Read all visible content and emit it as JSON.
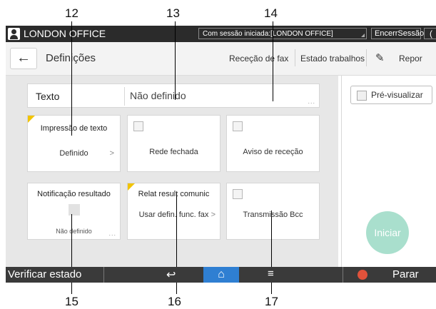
{
  "callouts": [
    "12",
    "13",
    "14",
    "15",
    "16",
    "17"
  ],
  "topbar": {
    "user_label": "LONDON OFFICE",
    "session_text": "Com sessão iniciada:[LONDON OFFICE]",
    "logout_label": "EncerrSessão",
    "moon_icon": "("
  },
  "header": {
    "back_icon": "←",
    "title": "Definições",
    "links": [
      "Receção de fax",
      "Estado trabalhos"
    ],
    "edit_icon": "✎",
    "reset_label": "Repor"
  },
  "texto_row": {
    "label": "Texto",
    "value": "Não definido",
    "dots": "..."
  },
  "tiles": [
    {
      "line1": "Impressão de texto",
      "line2": "Definido",
      "chevron": ">"
    },
    {
      "line2": "Rede fechada"
    },
    {
      "line2": "Aviso de receção"
    },
    {
      "line1": "Notificação resultado",
      "small": "Não definido",
      "dots": "..."
    },
    {
      "line1": "Relat result comunic",
      "line2": "Usar defin. func. fax",
      "chevron": ">"
    },
    {
      "line2": "Transmissão Bcc"
    }
  ],
  "preview": {
    "label": "Pré-visualizar"
  },
  "start_label": "Iniciar",
  "bottombar": {
    "verify_label": "Verificar estado",
    "back_icon": "↩",
    "home_icon": "⌂",
    "menu_icon": "≡",
    "stop_label": "Parar"
  },
  "colors": {
    "accent_yellow": "#f2c400",
    "start_green": "#a9dfcd",
    "home_blue": "#2f7fd2",
    "stop_red": "#e0523b"
  }
}
